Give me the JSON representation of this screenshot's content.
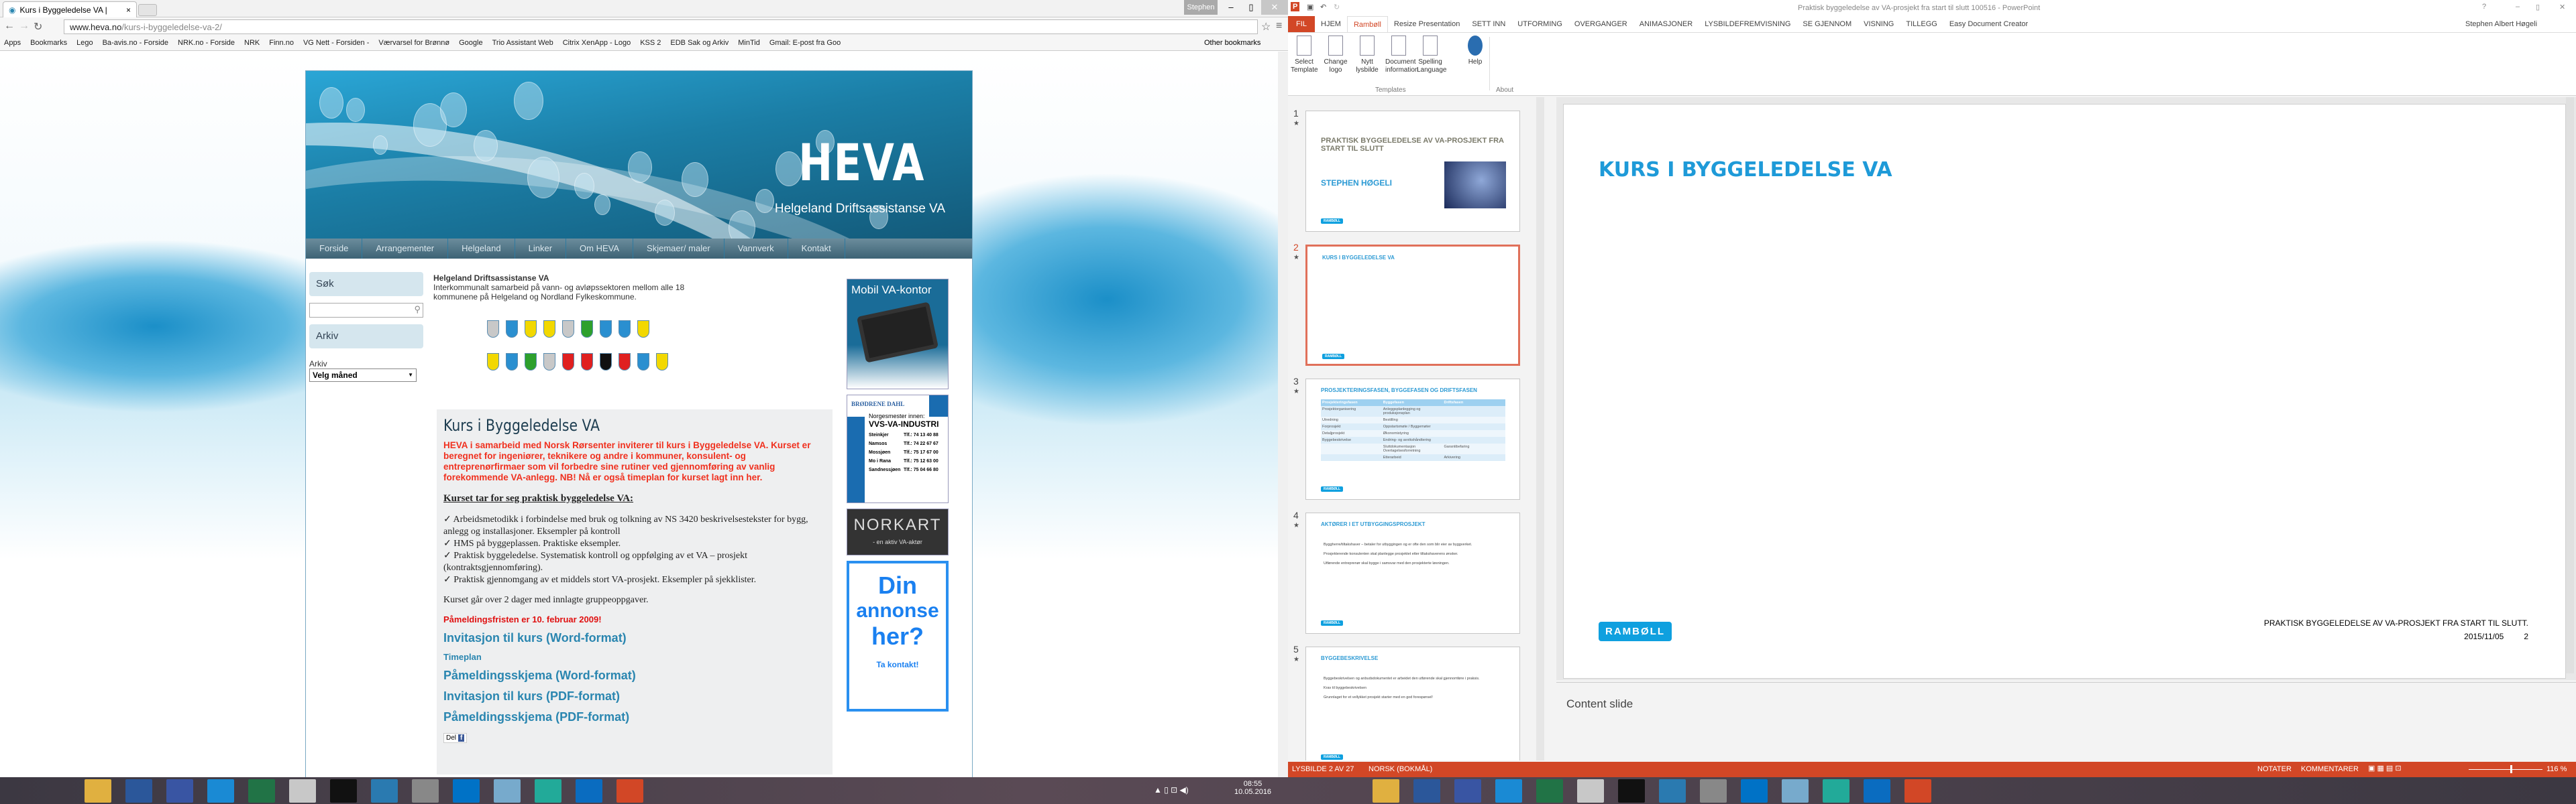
{
  "browser": {
    "tab_title": "Kurs i Byggeledelse VA |",
    "user": "Stephen",
    "url_domain": "www.heva.no",
    "url_path": "/kurs-i-byggeledelse-va-2/",
    "bookmarks": [
      "Apps",
      "Bookmarks",
      "Lego",
      "Ba-avis.no - Forside",
      "NRK.no - Forside",
      "NRK",
      "Finn.no",
      "VG Nett - Forsiden -",
      "Værvarsel for Brønnø",
      "Google",
      "Trio Assistant Web",
      "Citrix XenApp - Logo",
      "KSS 2",
      "EDB Sak og Arkiv",
      "MinTid",
      "Gmail: E-post fra Goo"
    ],
    "other_bookmarks": "Other bookmarks"
  },
  "site": {
    "logo": "HEVA",
    "logo_sub": "Helgeland Driftsassistanse VA",
    "nav": [
      "Forside",
      "Arrangementer",
      "Helgeland",
      "Linker",
      "Om HEVA",
      "Skjemaer/ maler",
      "Vannverk",
      "Kontakt"
    ],
    "sidebar": {
      "search_title": "Søk",
      "archive_title": "Arkiv",
      "archive_label": "Arkiv",
      "archive_select": "Velg måned"
    },
    "intro_title": "Helgeland Driftsassistanse VA",
    "intro_text": "Interkommunalt samarbeid på vann- og avløpssektoren mellom alle 18 kommunene på Helgeland og Nordland Fylkeskommune.",
    "shield_colors": [
      "#c8c8c8",
      "#2a8fd0",
      "#f2d800",
      "#f2d800",
      "#c8c8c8",
      "#2da02d",
      "#2a8fd0",
      "#2a8fd0",
      "#f2d800",
      "#f2d800",
      "#2a8fd0",
      "#2da02d",
      "#c8c8c8",
      "#e02020",
      "#e02020",
      "#111111",
      "#e02020",
      "#2a8fd0",
      "#f2d800"
    ],
    "article": {
      "title": "Kurs i Byggeledelse VA",
      "lead": "HEVA i samarbeid med Norsk Rørsenter inviterer til kurs i Byggeledelse VA. Kurset er beregnet for ingeniører, teknikere og andre i kommuner, konsulent- og entreprenørfirmaer som vil forbedre sine rutiner ved gjennomføring av vanlig forekommende VA-anlegg. NB! Nå er også timeplan for kurset lagt inn her.",
      "subheading": "Kurset tar for seg praktisk byggeledelse VA:",
      "items": [
        "✓ Arbeidsmetodikk i forbindelse med bruk og tolkning av NS 3420 beskrivelsestekster for bygg, anlegg og installasjoner. Eksempler på kontroll",
        "✓ HMS på byggeplassen. Praktiske eksempler.",
        "✓ Praktisk byggeledelse. Systematisk kontroll og oppfølging av et VA – prosjekt (kontraktsgjennomføring).",
        "✓ Praktisk gjennomgang av et middels stort VA-prosjekt. Eksempler på sjekklister."
      ],
      "duration": "Kurset går over 2 dager med innlagte gruppeoppgaver.",
      "deadline": "Påmeldingsfristen er 10. februar 2009!",
      "links": [
        "Invitasjon til kurs (Word-format)",
        "Timeplan",
        "Påmeldingsskjema (Word-format)",
        "Invitasjon til kurs (PDF-format)",
        "Påmeldingsskjema (PDF-format)"
      ],
      "share": "Del"
    },
    "ads": {
      "mobil": "Mobil VA-kontor",
      "bd_brand": "BRØDRENE DAHL",
      "bd_head": "Norgesmester innen:",
      "bd_title": "VVS-VA-INDUSTRI",
      "bd_rows": [
        [
          "Steinkjer",
          "Tlf.: 74 13 40 88"
        ],
        [
          "Namsos",
          "Tlf.: 74 22 67 67"
        ],
        [
          "Mossjøen",
          "Tlf.: 75 17 67 00"
        ],
        [
          "Mo i Rana",
          "Tlf.: 75 12 63 00"
        ],
        [
          "Sandnessjøen",
          "Tlf.: 75 04 66 80"
        ]
      ],
      "norkart": "NORKART",
      "norkart_sub": "- en aktiv VA-aktør",
      "din1": "Din",
      "din2": "annonse",
      "din3": "her?",
      "din_cta": "Ta kontakt!"
    }
  },
  "ppt": {
    "title": "Praktisk byggeledelse av VA-prosjekt fra start til slutt 100516 - PowerPoint",
    "tabs": [
      "FIL",
      "HJEM",
      "Rambøll",
      "Resize Presentation",
      "SETT INN",
      "UTFORMING",
      "OVERGANGER",
      "ANIMASJONER",
      "LYSBILDEFREMVISNING",
      "SE GJENNOM",
      "VISNING",
      "TILLEGG",
      "Easy Document Creator"
    ],
    "user": "Stephen Albert Høgeli",
    "ribbon": [
      [
        "Select",
        "Template"
      ],
      [
        "Change",
        "logo"
      ],
      [
        "Nytt",
        "lysbilde"
      ],
      [
        "Document",
        "information"
      ],
      [
        "Spelling",
        "Language"
      ],
      [
        "Help",
        ""
      ]
    ],
    "groups": [
      "Templates",
      "About"
    ],
    "slides": [
      {
        "n": "1",
        "title": "PRAKTISK BYGGELEDELSE AV VA-PROSJEKT FRA START TIL SLUTT",
        "sub": "STEPHEN HØGELI"
      },
      {
        "n": "2",
        "title": "KURS I BYGGELEDELSE VA"
      },
      {
        "n": "3",
        "title": "PROSJEKTERINGSFASEN, BYGGEFASEN OG DRIFTSFASEN",
        "headers": [
          "Prosjekteringsfasen",
          "Byggefasen",
          "Driftsfasen"
        ],
        "rows": [
          [
            "Prosjektorganisering",
            "Anleggsplanlegging og produksjonsplan",
            ""
          ],
          [
            "Utredning",
            "Bestilling",
            ""
          ],
          [
            "Forprosjekt",
            "Oppstartsmøte / Byggemøter",
            ""
          ],
          [
            "Detaljprosjekt",
            "Økonomistyring",
            ""
          ],
          [
            "Byggebeskrivelse",
            "Endring- og avvikshåndtering",
            ""
          ],
          [
            "",
            "Sluttdokumentasjon Overtagelsesforretning",
            "Garantibefaring"
          ],
          [
            "",
            "Etterarbeid",
            "Arkivering"
          ]
        ]
      },
      {
        "n": "4",
        "title": "AKTØRER I ET UTBYGGINGSPROSJEKT",
        "bullets": [
          "Byggherre/tiltakshaver – betaler for utbyggingen og er ofte den som blir eier av byggverket.",
          "Prosjekterende konsulenten skal planlegge prosjektet etter tiltakshaverens ønsker.",
          "Utførende entreprenør skal bygge i samsvar med den prosjekterte løsningen."
        ]
      },
      {
        "n": "5",
        "title": "BYGGEBESKRIVELSE",
        "bullets": [
          "Byggebeskrivelsen og anbudsdokumentet er arbeidet den utførende skal gjennomføre i praksis.",
          "Krav til byggebeskrivelsen",
          "Grunnlaget for et vellykket prosjekt starter med en god forespørsel!"
        ]
      }
    ],
    "main_slide": {
      "title": "KURS I BYGGELEDELSE VA",
      "logo": "RAMBØLL",
      "footer": "PRAKTISK BYGGELEDELSE AV VA-PROSJEKT FRA START TIL SLUTT.",
      "date": "2015/11/05",
      "page": "2"
    },
    "notes": "Content slide",
    "status": {
      "slide": "LYSBILDE 2 AV 27",
      "lang": "NORSK (BOKMÅL)",
      "notes": "NOTATER",
      "comments": "KOMMENTARER",
      "zoom": "116 %"
    }
  },
  "taskbar": {
    "time": "08:55",
    "date": "10.05.2016",
    "apps": [
      "start",
      "ie",
      "explorer",
      "word",
      "visio",
      "dm",
      "excel",
      "acrobat",
      "notepad",
      "hiveworks",
      "chrome",
      "outlook",
      "notes",
      "vpn",
      "lync",
      "powerpoint"
    ]
  }
}
